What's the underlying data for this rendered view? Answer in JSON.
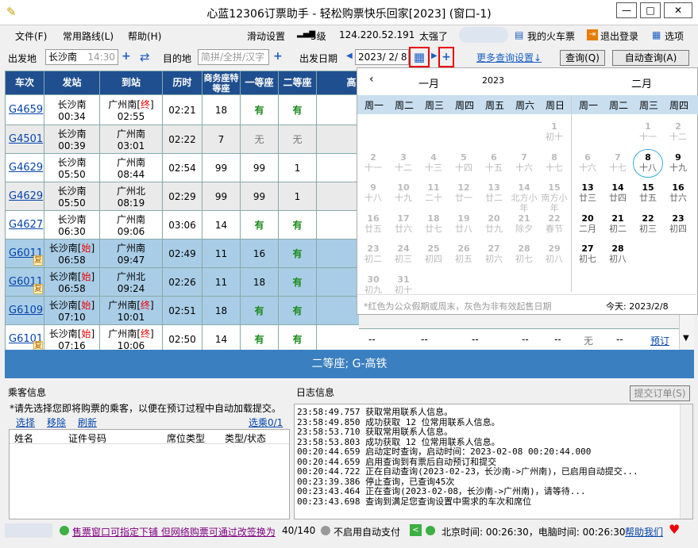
{
  "window": {
    "title": "心蓝12306订票助手 - 轻松购票快乐回家[2023] (窗口-1)",
    "min": "—",
    "max": "□",
    "close": "✕"
  },
  "menu": {
    "file": "文件(F)",
    "routes": "常用路线(L)",
    "help": "帮助(H)",
    "slide": "滑动设置",
    "signal": "5级",
    "ip": "124.220.52.191",
    "speed": "太强了",
    "my_tickets": "我的火车票",
    "logout": "退出登录",
    "options": "选项"
  },
  "toolbar": {
    "from_label": "出发地",
    "from_value": "长沙南",
    "from_time": "14:30",
    "to_label": "目的地",
    "to_placeholder": "简拼/全拼/汉字",
    "date_label": "出发日期",
    "date_value": "2023/ 2/ 8",
    "more_settings": "更多查询设置↓",
    "query": "查询(Q)",
    "auto_query": "自动查询(A)"
  },
  "table": {
    "headers": [
      "车次",
      "发站",
      "到站",
      "历时",
      "商务座特等座",
      "一等座",
      "二等座",
      "高"
    ],
    "rows": [
      {
        "train": "G4659",
        "from": "长沙南",
        "from_tag": "",
        "dep": "00:34",
        "to": "广州南",
        "to_tag": "终",
        "arr": "02:55",
        "dur": "02:21",
        "biz": "18",
        "first": "有",
        "second": "有",
        "fu": ""
      },
      {
        "train": "G4501",
        "from": "长沙南",
        "from_tag": "",
        "dep": "00:39",
        "to": "广州南",
        "to_tag": "",
        "arr": "03:01",
        "dur": "02:22",
        "biz": "7",
        "first": "无",
        "second": "无",
        "fu": ""
      },
      {
        "train": "G4629",
        "from": "长沙南",
        "from_tag": "",
        "dep": "05:50",
        "to": "广州南",
        "to_tag": "",
        "arr": "08:44",
        "dur": "02:54",
        "biz": "99",
        "first": "99",
        "second": "1",
        "fu": ""
      },
      {
        "train": "G4629",
        "from": "长沙南",
        "from_tag": "",
        "dep": "05:50",
        "to": "广州北",
        "to_tag": "",
        "arr": "08:19",
        "dur": "02:29",
        "biz": "99",
        "first": "99",
        "second": "1",
        "fu": ""
      },
      {
        "train": "G4627",
        "from": "长沙南",
        "from_tag": "",
        "dep": "06:30",
        "to": "广州南",
        "to_tag": "",
        "arr": "09:06",
        "dur": "03:06",
        "biz": "14",
        "first": "有",
        "second": "有",
        "fu": ""
      },
      {
        "train": "G6011",
        "from": "长沙南",
        "from_tag": "始",
        "dep": "06:58",
        "to": "广州南",
        "to_tag": "",
        "arr": "09:47",
        "dur": "02:49",
        "biz": "11",
        "first": "16",
        "second": "有",
        "fu": "复"
      },
      {
        "train": "G6011",
        "from": "长沙南",
        "from_tag": "始",
        "dep": "06:58",
        "to": "广州北",
        "to_tag": "",
        "arr": "09:24",
        "dur": "02:26",
        "biz": "11",
        "first": "18",
        "second": "有",
        "fu": "复"
      },
      {
        "train": "G6109",
        "from": "长沙南",
        "from_tag": "始",
        "dep": "07:10",
        "to": "广州南",
        "to_tag": "终",
        "arr": "10:01",
        "dur": "02:51",
        "biz": "18",
        "first": "有",
        "second": "有",
        "fu": ""
      },
      {
        "train": "G6101",
        "from": "长沙南",
        "from_tag": "始",
        "dep": "07:16",
        "to": "广州南",
        "to_tag": "终",
        "arr": "10:06",
        "dur": "02:50",
        "biz": "14",
        "first": "有",
        "second": "有",
        "fu": "复"
      }
    ],
    "last_row_extra": {
      "dashes": "--",
      "wu": "无",
      "book": "预订"
    }
  },
  "banner": "二等座; G-高铁",
  "calendar": {
    "left_month": "一月",
    "left_year": "2023",
    "right_month": "二月",
    "weekdays": [
      "周一",
      "周二",
      "周三",
      "周四",
      "周五",
      "周六",
      "周日"
    ],
    "right_weekdays": [
      "周一",
      "周二",
      "周三",
      "周四"
    ],
    "jan": [
      [
        "",
        ""
      ],
      [
        "",
        ""
      ],
      [
        "",
        ""
      ],
      [
        "",
        ""
      ],
      [
        "",
        ""
      ],
      [
        "",
        ""
      ],
      [
        "1",
        "初十"
      ],
      [
        "2",
        "十一"
      ],
      [
        "3",
        "十二"
      ],
      [
        "4",
        "十三"
      ],
      [
        "5",
        "十四"
      ],
      [
        "6",
        "十五"
      ],
      [
        "7",
        "十六"
      ],
      [
        "8",
        "十七"
      ],
      [
        "9",
        "十八"
      ],
      [
        "10",
        "十九"
      ],
      [
        "11",
        "二十"
      ],
      [
        "12",
        "廿一"
      ],
      [
        "13",
        "廿二"
      ],
      [
        "14",
        "北方小年"
      ],
      [
        "15",
        "南方小年"
      ],
      [
        "16",
        "廿五"
      ],
      [
        "17",
        "廿六"
      ],
      [
        "18",
        "廿七"
      ],
      [
        "19",
        "廿八"
      ],
      [
        "20",
        "廿九"
      ],
      [
        "21",
        "除夕"
      ],
      [
        "22",
        "春节"
      ],
      [
        "23",
        "初二"
      ],
      [
        "24",
        "初三"
      ],
      [
        "25",
        "初四"
      ],
      [
        "26",
        "初五"
      ],
      [
        "27",
        "初六"
      ],
      [
        "28",
        "初七"
      ],
      [
        "29",
        "初八"
      ],
      [
        "30",
        "初九"
      ],
      [
        "31",
        "初十"
      ]
    ],
    "feb": [
      [
        "",
        ""
      ],
      [
        "",
        ""
      ],
      [
        "1",
        "十一"
      ],
      [
        "2",
        "十二"
      ],
      [
        "6",
        "十六"
      ],
      [
        "7",
        "十七"
      ],
      [
        "8",
        "十八"
      ],
      [
        "9",
        "十九"
      ],
      [
        "13",
        "廿三"
      ],
      [
        "14",
        "廿四"
      ],
      [
        "15",
        "廿五"
      ],
      [
        "16",
        "廿六"
      ],
      [
        "20",
        "二月"
      ],
      [
        "21",
        "初二"
      ],
      [
        "22",
        "初三"
      ],
      [
        "23",
        "初四"
      ],
      [
        "27",
        "初七"
      ],
      [
        "28",
        "初八"
      ],
      [
        "",
        ""
      ],
      [
        "",
        ""
      ]
    ],
    "note": "*红色为公众假期或周末，灰色为非有效起售日期",
    "today": "今天: 2023/2/8"
  },
  "passengers": {
    "title": "乘客信息",
    "hint": "*请先选择您即将购票的乘客，以便在预订过程中自动加载提交。",
    "select": "选择",
    "remove": "移除",
    "refresh": "刷新",
    "count": "选乘0/1",
    "cols": [
      "姓名",
      "证件号码",
      "席位类型",
      "类型/状态"
    ]
  },
  "log": {
    "title": "日志信息",
    "submit": "提交订单(S)",
    "lines": [
      "23:58:49.757 获取常用联系人信息。",
      "23:58:49.850 成功获取 12 位常用联系人信息。",
      "23:58:53.710 获取常用联系人信息。",
      "23:58:53.803 成功获取 12 位常用联系人信息。",
      "00:20:44.659 启动定时查询，启动时间：2023-02-08 00:20:44.000",
      "00:20:44.659 启用查询到有票后自动预订和提交",
      "00:20:44.722 正在自动查询(2023-02-23，长沙南->广州南)，已启用自动提交...",
      "00:23:39.386 停止查询，已查询45次",
      "00:23:43.464 正在查询(2023-02-08，长沙南->广州南)，请等待...",
      "00:23:43.698 查询到满足您查询设置中需求的车次和席位"
    ]
  },
  "status": {
    "marquee": "售票窗口可指定下铺 但网络购票可通过改签换为",
    "count": "40/140",
    "autopay": "不启用自动支付",
    "clock": "北京时间: 00:26:30，电脑时间: 00:26:30",
    "help": "帮助我们"
  }
}
